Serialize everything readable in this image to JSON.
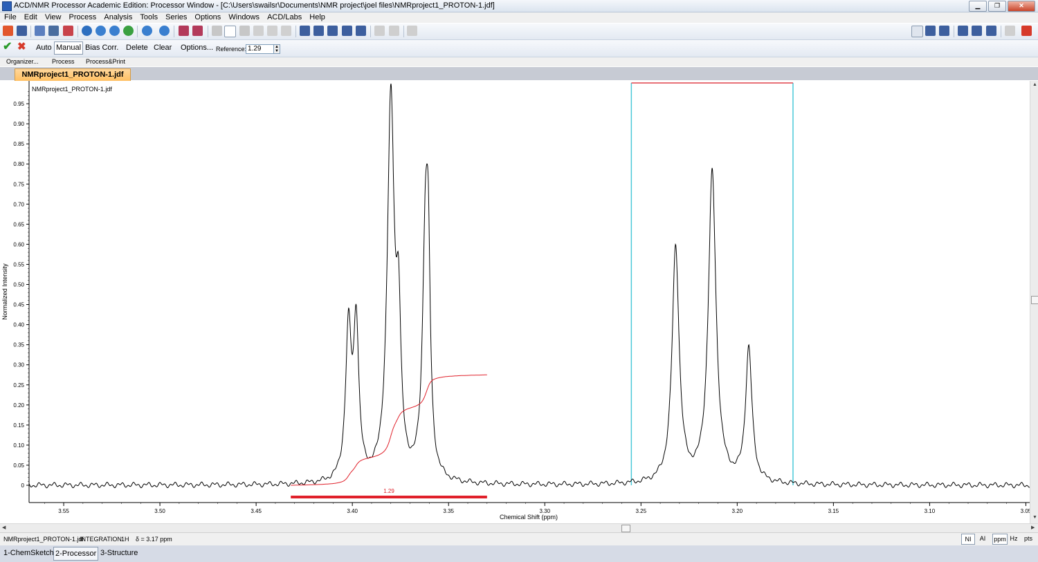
{
  "window": {
    "title": "ACD/NMR Processor Academic Edition: Processor Window - [C:\\Users\\swailsr\\Documents\\NMR project\\joel files\\NMRproject1_PROTON-1.jdf]"
  },
  "menu": [
    "File",
    "Edit",
    "View",
    "Process",
    "Analysis",
    "Tools",
    "Series",
    "Options",
    "Windows",
    "ACD/Labs",
    "Help"
  ],
  "integration_toolbar": {
    "auto": "Auto",
    "manual": "Manual",
    "bias": "Bias Corr.",
    "delete": "Delete",
    "clear": "Clear",
    "options": "Options...",
    "reference_label": "Reference:",
    "reference_value": "1.29"
  },
  "view_tabs": [
    "Organizer...",
    "Process",
    "Process&Print"
  ],
  "document_tab": "NMRproject1_PROTON-1.jdf",
  "chart_data": {
    "type": "line",
    "title": "NMRproject1_PROTON-1.jdf",
    "xlabel": "Chemical Shift (ppm)",
    "ylabel": "Normalized Intensity",
    "xlim": [
      3.568,
      3.048
    ],
    "ylim": [
      -0.04,
      1.0
    ],
    "x_reversed": true,
    "x_ticks": [
      "3.55",
      "3.50",
      "3.45",
      "3.40",
      "3.35",
      "3.30",
      "3.25",
      "3.20",
      "3.15",
      "3.10",
      "3.05"
    ],
    "y_ticks": [
      "0",
      "0.05",
      "0.10",
      "0.15",
      "0.20",
      "0.25",
      "0.30",
      "0.35",
      "0.40",
      "0.45",
      "0.50",
      "0.55",
      "0.60",
      "0.65",
      "0.70",
      "0.75",
      "0.80",
      "0.85",
      "0.90",
      "0.95"
    ],
    "peaks": [
      {
        "ppm": 3.402,
        "height": 0.44
      },
      {
        "ppm": 3.398,
        "height": 0.45
      },
      {
        "ppm": 3.38,
        "height": 1.0
      },
      {
        "ppm": 3.376,
        "height": 0.57
      },
      {
        "ppm": 3.362,
        "height": 0.76
      },
      {
        "ppm": 3.3605,
        "height": 0.75
      },
      {
        "ppm": 3.232,
        "height": 0.6
      },
      {
        "ppm": 3.213,
        "height": 0.79
      },
      {
        "ppm": 3.194,
        "height": 0.35
      }
    ],
    "integral": {
      "from": 3.432,
      "to": 3.33,
      "label": "1.29"
    },
    "selection": {
      "from": 3.255,
      "to": 3.171
    }
  },
  "status": {
    "file": "NMRproject1_PROTON-1.jdf",
    "mode": "INTEGRATION",
    "nucleus": "1H",
    "shift": "δ = 3.17 ppm",
    "units": [
      "NI",
      "AI",
      "ppm",
      "Hz",
      "pts"
    ]
  },
  "bottom_tabs": [
    "1-ChemSketch",
    "2-Processor",
    "3-Structure"
  ]
}
